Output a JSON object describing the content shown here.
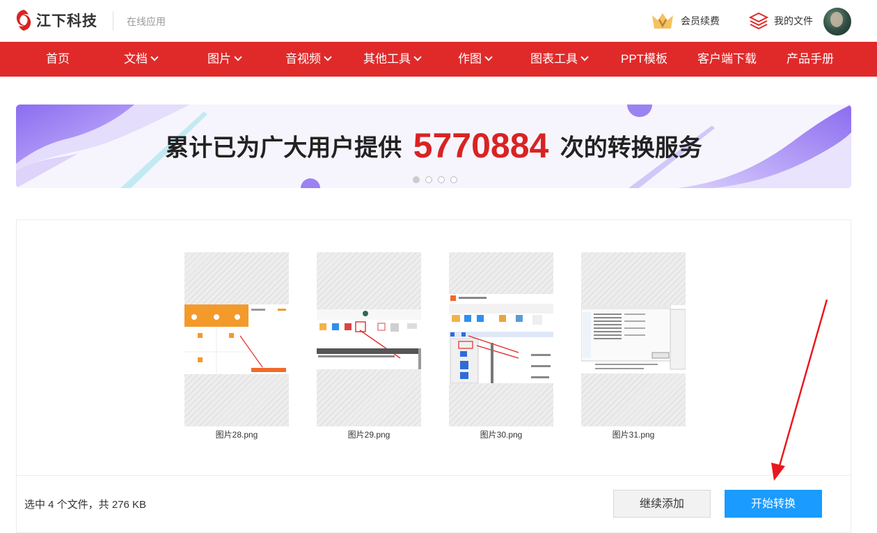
{
  "header": {
    "logo_text": "江下科技",
    "logo_sub": "在线应用",
    "member_label": "会员续费",
    "myfiles_label": "我的文件"
  },
  "nav": {
    "items": [
      {
        "label": "首页",
        "dropdown": false
      },
      {
        "label": "文档",
        "dropdown": true
      },
      {
        "label": "图片",
        "dropdown": true
      },
      {
        "label": "音视频",
        "dropdown": true
      },
      {
        "label": "其他工具",
        "dropdown": true
      },
      {
        "label": "作图",
        "dropdown": true
      },
      {
        "label": "图表工具",
        "dropdown": true
      },
      {
        "label": "PPT模板",
        "dropdown": false
      },
      {
        "label": "客户端下载",
        "dropdown": false
      },
      {
        "label": "产品手册",
        "dropdown": false
      }
    ]
  },
  "banner": {
    "prefix": "累计已为广大用户提供",
    "count": "5770884",
    "suffix": "次的转换服务",
    "active_slide": 1,
    "slide_count": 4
  },
  "files": [
    {
      "name": "图片28.png"
    },
    {
      "name": "图片29.png"
    },
    {
      "name": "图片30.png"
    },
    {
      "name": "图片31.png"
    }
  ],
  "footer": {
    "summary": "选中 4 个文件，共 276 KB",
    "add_label": "继续添加",
    "start_label": "开始转换"
  },
  "colors": {
    "brand_red": "#e02a2a",
    "count_red": "#d92323",
    "primary_blue": "#1a9bff"
  }
}
